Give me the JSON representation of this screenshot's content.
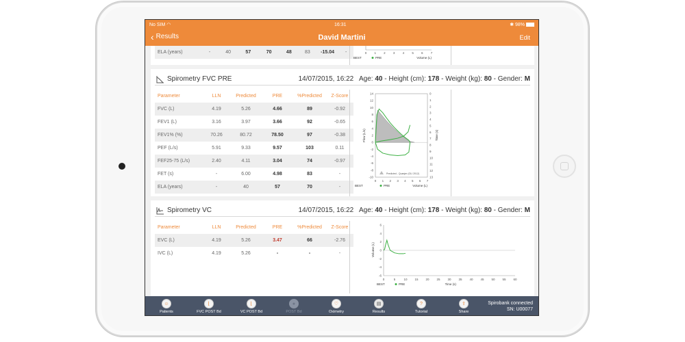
{
  "status_bar": {
    "carrier": "No SIM",
    "time": "16:31",
    "battery": "98%"
  },
  "nav": {
    "back_label": "Results",
    "title": "David Martini",
    "edit_label": "Edit"
  },
  "top_partial": {
    "row": {
      "param": "ELA (years)",
      "lln": "-",
      "predicted": "40",
      "pre": "57",
      "c4": "70",
      "c5": "48",
      "c6": "83",
      "c7": "-15.04",
      "c8": "-"
    },
    "chart_ticks": [
      "0",
      "1",
      "2",
      "3",
      "4",
      "5",
      "6",
      "7"
    ],
    "legend_best": "BEST",
    "legend_pre": "PRE",
    "xlabel": "Volume (L)"
  },
  "fvc_card": {
    "title": "Spirometry FVC PRE",
    "datetime": "14/07/2015, 16:22",
    "age_label": "Age:",
    "age": "40",
    "height_label": "Height (cm):",
    "height": "178",
    "weight_label": "Weight (kg):",
    "weight": "80",
    "gender_label": "Gender:",
    "gender": "M",
    "headers": [
      "Parameter",
      "LLN",
      "Predicted",
      "PRE",
      "%Predicted",
      "Z-Score"
    ],
    "rows": [
      [
        "FVC (L)",
        "4.19",
        "5.26",
        "4.66",
        "89",
        "-0.92"
      ],
      [
        "FEV1 (L)",
        "3.16",
        "3.97",
        "3.66",
        "92",
        "-0.65"
      ],
      [
        "FEV1% (%)",
        "70.26",
        "80.72",
        "78.50",
        "97",
        "-0.38"
      ],
      [
        "PEF (L/s)",
        "5.91",
        "9.33",
        "9.57",
        "103",
        "0.11"
      ],
      [
        "FEF25-75 (L/s)",
        "2.40",
        "4.11",
        "3.04",
        "74",
        "-0.97"
      ],
      [
        "FET (s)",
        "-",
        "6.00",
        "4.98",
        "83",
        "-"
      ],
      [
        "ELA (years)",
        "-",
        "40",
        "57",
        "70",
        "-"
      ]
    ]
  },
  "fvc_chart": {
    "type": "line",
    "ylabel_left": "Flow (L/s)",
    "ylabel_right": "Time (s)",
    "xlabel": "Volume (L)",
    "xlim": [
      0,
      7
    ],
    "ylim": [
      -10,
      14
    ],
    "x_ticks": [
      "0",
      "1",
      "2",
      "3",
      "4",
      "5",
      "6",
      "7"
    ],
    "y_ticks_left": [
      "14",
      "12",
      "10",
      "8",
      "6",
      "4",
      "2",
      "0",
      "-2",
      "-4",
      "-6",
      "-8",
      "-10"
    ],
    "y_ticks_right": [
      "0",
      "1",
      "2",
      "3",
      "4",
      "5",
      "6",
      "7",
      "8",
      "9",
      "10",
      "11",
      "12",
      "13"
    ],
    "legend_best": "BEST",
    "legend_pre": "PRE",
    "predicted_note": "Predicted - Quanjer (GLI 2012)",
    "series": [
      {
        "name": "PRE",
        "color": "#3cb043",
        "points": [
          [
            0,
            0
          ],
          [
            0.2,
            8
          ],
          [
            0.5,
            9.6
          ],
          [
            1,
            8.5
          ],
          [
            1.5,
            7
          ],
          [
            2,
            5.6
          ],
          [
            2.5,
            4.4
          ],
          [
            3,
            3.3
          ],
          [
            3.5,
            2.3
          ],
          [
            4,
            1.4
          ],
          [
            4.5,
            0.6
          ],
          [
            4.66,
            0
          ],
          [
            4.5,
            -2.8
          ],
          [
            4,
            -3.6
          ],
          [
            3,
            -3.8
          ],
          [
            2,
            -3.6
          ],
          [
            1,
            -3.1
          ],
          [
            0.3,
            -2
          ],
          [
            0,
            0
          ]
        ]
      },
      {
        "name": "PRE volume-time",
        "color": "#3cb043",
        "points": [
          [
            0,
            0
          ],
          [
            0.8,
            0.4
          ],
          [
            2,
            0.8
          ],
          [
            3,
            1.2
          ],
          [
            3.8,
            1.8
          ],
          [
            4.4,
            3
          ],
          [
            4.66,
            5
          ]
        ]
      }
    ],
    "predicted_area": [
      [
        0,
        0
      ],
      [
        0.3,
        9.3
      ],
      [
        0.8,
        8
      ],
      [
        1.5,
        6.2
      ],
      [
        2.5,
        4
      ],
      [
        3.5,
        2
      ],
      [
        4.5,
        0.4
      ],
      [
        5.26,
        0
      ],
      [
        0,
        0
      ]
    ]
  },
  "vc_card": {
    "title": "Spirometry VC",
    "datetime": "14/07/2015, 16:22",
    "age_label": "Age:",
    "age": "40",
    "height_label": "Height (cm):",
    "height": "178",
    "weight_label": "Weight (kg):",
    "weight": "80",
    "gender_label": "Gender:",
    "gender": "M",
    "headers": [
      "Parameter",
      "LLN",
      "Predicted",
      "PRE",
      "%Predicted",
      "Z-Score"
    ],
    "rows": [
      [
        "EVC (L)",
        "4.19",
        "5.26",
        "3.47",
        "66",
        "-2.76"
      ],
      [
        "IVC (L)",
        "4.19",
        "5.26",
        "-",
        "-",
        "-"
      ]
    ]
  },
  "vc_chart": {
    "type": "line",
    "ylabel": "Volume (L)",
    "xlabel": "Time (s)",
    "xlim": [
      0,
      60
    ],
    "ylim": [
      -6,
      6
    ],
    "x_ticks": [
      "0",
      "5",
      "10",
      "15",
      "20",
      "25",
      "30",
      "35",
      "40",
      "45",
      "50",
      "55",
      "60"
    ],
    "y_ticks": [
      "6",
      "4",
      "2",
      "0",
      "-2",
      "-4",
      "-6"
    ],
    "legend_best": "BEST",
    "legend_pre": "PRE",
    "series": [
      {
        "name": "PRE",
        "color": "#3cb043",
        "points": [
          [
            0,
            0
          ],
          [
            0.5,
            0.3
          ],
          [
            1,
            1.5
          ],
          [
            1.5,
            2.4
          ],
          [
            2,
            1.4
          ],
          [
            3,
            0
          ],
          [
            5,
            -0.6
          ],
          [
            7,
            -0.8
          ],
          [
            9,
            -0.8
          ],
          [
            10,
            -0.7
          ]
        ]
      }
    ]
  },
  "tab_bar": {
    "tabs": [
      {
        "label": "Patients",
        "icon": "patients-icon",
        "state": "normal"
      },
      {
        "label": "FVC POST Bd",
        "icon": "fvc-chart-icon",
        "state": "normal"
      },
      {
        "label": "VC POST Bd",
        "icon": "vc-chart-icon",
        "state": "normal"
      },
      {
        "label": "POST Bd",
        "icon": "post-bd-icon",
        "state": "disabled"
      },
      {
        "label": "Oximetry",
        "icon": "heart-icon",
        "state": "normal"
      },
      {
        "label": "Results",
        "icon": "results-icon",
        "state": "active"
      },
      {
        "label": "Tutorial",
        "icon": "help-icon",
        "state": "normal"
      },
      {
        "label": "Share",
        "icon": "share-icon",
        "state": "normal"
      }
    ],
    "connection_line1": "Spirobank connected",
    "connection_line2": "SN: U00077"
  },
  "colors": {
    "accent": "#ee8a3a",
    "tabbar": "#4a5568",
    "series": "#3cb043",
    "alert": "#c0392b"
  }
}
